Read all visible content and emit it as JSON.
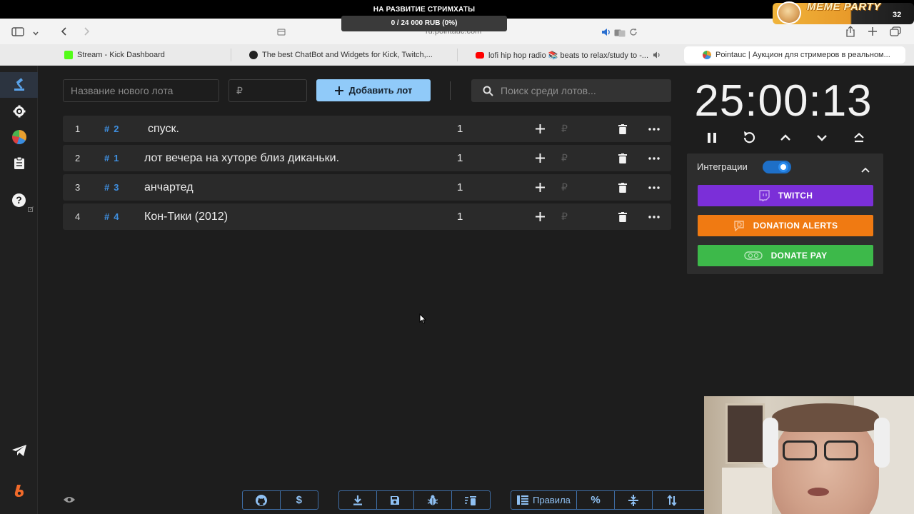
{
  "stream_overlay": {
    "goal_title": "НА РАЗВИТИЕ СТРИМХАТЫ",
    "goal_progress_text": "0 / 24 000 RUB (0%)",
    "goal_progress": 0,
    "meme_title": "MEME PARTY",
    "meme_count": "32"
  },
  "browser": {
    "url": "ru.pointauc.com",
    "tabs": [
      {
        "label": "Stream - Kick Dashboard",
        "icon": "kick-icon",
        "color": "#53fc18"
      },
      {
        "label": "The best ChatBot and Widgets for Kick, Twitch,...",
        "icon": "botrix-icon",
        "color": "#222222"
      },
      {
        "label": "lofi hip hop radio 📚 beats to relax/study to -...",
        "icon": "youtube-icon",
        "color": "#ff0000"
      },
      {
        "label": "Pointauc | Аукцион для стримеров в реальном...",
        "icon": "pointauc-icon",
        "color": "#e8a030"
      }
    ]
  },
  "sidebar": {
    "items": [
      {
        "name": "auction-icon",
        "active": true
      },
      {
        "name": "settings-icon"
      },
      {
        "name": "wheel-icon"
      },
      {
        "name": "history-icon"
      },
      {
        "name": "help-icon"
      }
    ],
    "bottom": [
      {
        "name": "telegram-icon"
      },
      {
        "name": "boosty-icon"
      }
    ]
  },
  "toolbar": {
    "lot_name_placeholder": "Название нового лота",
    "amount_placeholder": "₽",
    "add_lot_label": "Добавить лот",
    "search_placeholder": "Поиск среди лотов..."
  },
  "lots": [
    {
      "index": "1",
      "id": "2",
      "name": "спуск.",
      "amount": "1",
      "currency": "₽"
    },
    {
      "index": "2",
      "id": "1",
      "name": "лот вечера на хуторе близ диканьки.",
      "amount": "1",
      "currency": "₽"
    },
    {
      "index": "3",
      "id": "3",
      "name": "анчартед",
      "amount": "1",
      "currency": "₽"
    },
    {
      "index": "4",
      "id": "4",
      "name": "Кон-Тики (2012)",
      "amount": "1",
      "currency": "₽"
    }
  ],
  "timer": {
    "value": "25:00:13"
  },
  "integrations": {
    "label": "Интеграции",
    "enabled": true,
    "buttons": [
      {
        "label": "TWITCH",
        "color": "#7b2fd8",
        "icon": "twitch-icon"
      },
      {
        "label": "DONATION ALERTS",
        "color": "#f07a12",
        "icon": "donationalerts-icon"
      },
      {
        "label": "DONATE PAY",
        "color": "#3db94a",
        "icon": "donatepay-icon"
      }
    ]
  },
  "bottom_toolbar": {
    "rules_label": "Правила"
  },
  "colors": {
    "accent": "#90caf9",
    "background": "#1d1d1d",
    "row": "#2a2a2a",
    "lot_id": "#3f8fe0"
  }
}
